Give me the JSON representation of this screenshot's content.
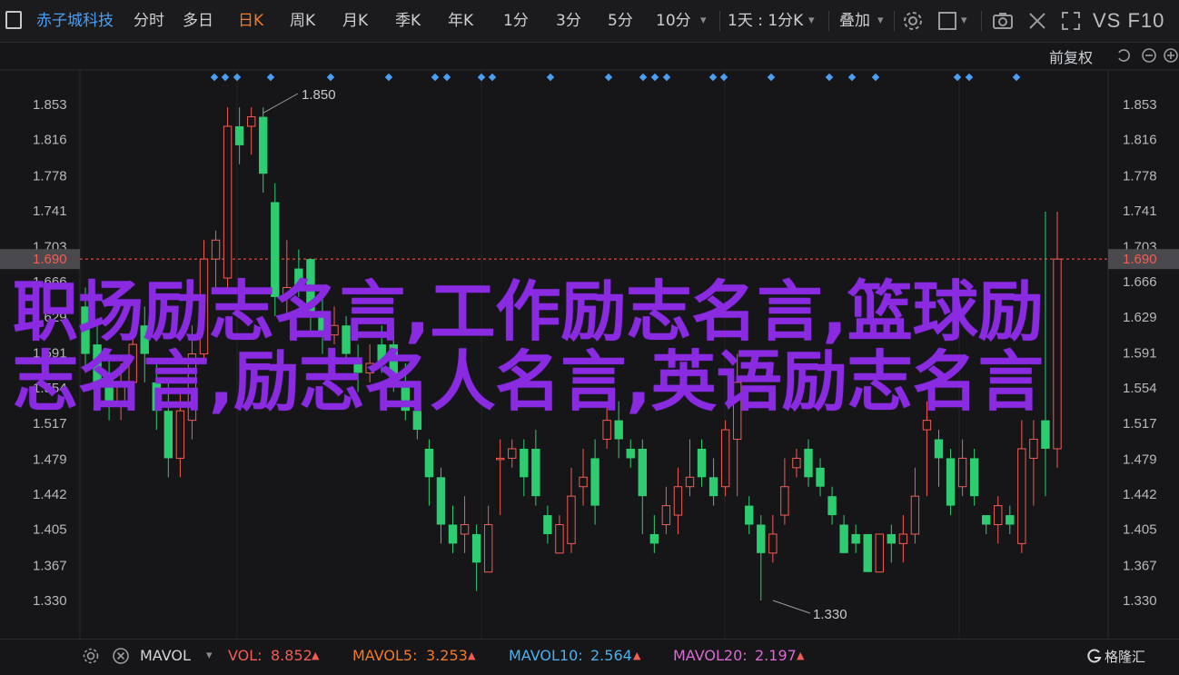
{
  "toolbar": {
    "stock_name": "赤子城科技",
    "periods": [
      "分时",
      "多日",
      "日K",
      "周K",
      "月K",
      "季K",
      "年K",
      "1分",
      "3分",
      "5分",
      "10分"
    ],
    "active_period": "日K",
    "dropdown_label": "1天 : 1分K",
    "indicator_label": "叠加",
    "brand": "VS F10"
  },
  "subbar": {
    "adjust_label": "前复权"
  },
  "chart": {
    "y_ticks": [
      "1.853",
      "1.816",
      "1.778",
      "1.741",
      "1.703",
      "1.666",
      "1.629",
      "1.591",
      "1.554",
      "1.517",
      "1.479",
      "1.442",
      "1.405",
      "1.367",
      "1.330"
    ],
    "y_tick_values": [
      1.853,
      1.816,
      1.778,
      1.741,
      1.703,
      1.666,
      1.629,
      1.591,
      1.554,
      1.517,
      1.479,
      1.442,
      1.405,
      1.367,
      1.33
    ],
    "current_price_label": "1.690",
    "current_price": 1.69,
    "high_label": "1.850",
    "low_label": "1.330",
    "colors": {
      "up": "#f25c54",
      "down": "#2ecc71",
      "marker": "#4a9ff5",
      "price_line": "#f25c54"
    }
  },
  "chart_data": {
    "type": "candlestick",
    "ylim": [
      1.318,
      1.868
    ],
    "candles": [
      {
        "o": 1.64,
        "c": 1.59,
        "h": 1.66,
        "l": 1.57
      },
      {
        "o": 1.6,
        "c": 1.56,
        "h": 1.62,
        "l": 1.54
      },
      {
        "o": 1.57,
        "c": 1.54,
        "h": 1.59,
        "l": 1.52
      },
      {
        "o": 1.54,
        "c": 1.56,
        "h": 1.58,
        "l": 1.52
      },
      {
        "o": 1.56,
        "c": 1.6,
        "h": 1.61,
        "l": 1.55
      },
      {
        "o": 1.62,
        "c": 1.59,
        "h": 1.64,
        "l": 1.56
      },
      {
        "o": 1.56,
        "c": 1.53,
        "h": 1.58,
        "l": 1.51
      },
      {
        "o": 1.53,
        "c": 1.48,
        "h": 1.56,
        "l": 1.46
      },
      {
        "o": 1.48,
        "c": 1.53,
        "h": 1.55,
        "l": 1.46
      },
      {
        "o": 1.52,
        "c": 1.59,
        "h": 1.62,
        "l": 1.5
      },
      {
        "o": 1.59,
        "c": 1.69,
        "h": 1.71,
        "l": 1.58
      },
      {
        "o": 1.69,
        "c": 1.71,
        "h": 1.72,
        "l": 1.66
      },
      {
        "o": 1.67,
        "c": 1.83,
        "h": 1.85,
        "l": 1.66
      },
      {
        "o": 1.83,
        "c": 1.81,
        "h": 1.85,
        "l": 1.79
      },
      {
        "o": 1.83,
        "c": 1.84,
        "h": 1.85,
        "l": 1.8
      },
      {
        "o": 1.84,
        "c": 1.78,
        "h": 1.85,
        "l": 1.76
      },
      {
        "o": 1.75,
        "c": 1.65,
        "h": 1.77,
        "l": 1.63
      },
      {
        "o": 1.65,
        "c": 1.66,
        "h": 1.71,
        "l": 1.63
      },
      {
        "o": 1.68,
        "c": 1.66,
        "h": 1.7,
        "l": 1.65
      },
      {
        "o": 1.69,
        "c": 1.63,
        "h": 1.69,
        "l": 1.61
      },
      {
        "o": 1.63,
        "c": 1.61,
        "h": 1.65,
        "l": 1.59
      },
      {
        "o": 1.61,
        "c": 1.62,
        "h": 1.64,
        "l": 1.6
      },
      {
        "o": 1.62,
        "c": 1.59,
        "h": 1.63,
        "l": 1.58
      },
      {
        "o": 1.58,
        "c": 1.57,
        "h": 1.6,
        "l": 1.55
      },
      {
        "o": 1.57,
        "c": 1.58,
        "h": 1.6,
        "l": 1.56
      },
      {
        "o": 1.6,
        "c": 1.58,
        "h": 1.62,
        "l": 1.57
      },
      {
        "o": 1.6,
        "c": 1.56,
        "h": 1.62,
        "l": 1.55
      },
      {
        "o": 1.56,
        "c": 1.53,
        "h": 1.58,
        "l": 1.52
      },
      {
        "o": 1.53,
        "c": 1.51,
        "h": 1.55,
        "l": 1.5
      },
      {
        "o": 1.49,
        "c": 1.46,
        "h": 1.5,
        "l": 1.43
      },
      {
        "o": 1.46,
        "c": 1.41,
        "h": 1.47,
        "l": 1.39
      },
      {
        "o": 1.41,
        "c": 1.39,
        "h": 1.43,
        "l": 1.38
      },
      {
        "o": 1.4,
        "c": 1.41,
        "h": 1.44,
        "l": 1.38
      },
      {
        "o": 1.4,
        "c": 1.37,
        "h": 1.41,
        "l": 1.34
      },
      {
        "o": 1.36,
        "c": 1.41,
        "h": 1.43,
        "l": 1.36
      },
      {
        "o": 1.48,
        "c": 1.48,
        "h": 1.5,
        "l": 1.42
      },
      {
        "o": 1.48,
        "c": 1.49,
        "h": 1.5,
        "l": 1.47
      },
      {
        "o": 1.49,
        "c": 1.46,
        "h": 1.5,
        "l": 1.44
      },
      {
        "o": 1.49,
        "c": 1.44,
        "h": 1.51,
        "l": 1.43
      },
      {
        "o": 1.42,
        "c": 1.4,
        "h": 1.43,
        "l": 1.39
      },
      {
        "o": 1.38,
        "c": 1.41,
        "h": 1.42,
        "l": 1.38
      },
      {
        "o": 1.39,
        "c": 1.44,
        "h": 1.47,
        "l": 1.38
      },
      {
        "o": 1.45,
        "c": 1.46,
        "h": 1.49,
        "l": 1.43
      },
      {
        "o": 1.48,
        "c": 1.43,
        "h": 1.5,
        "l": 1.41
      },
      {
        "o": 1.5,
        "c": 1.52,
        "h": 1.54,
        "l": 1.49
      },
      {
        "o": 1.52,
        "c": 1.5,
        "h": 1.54,
        "l": 1.48
      },
      {
        "o": 1.49,
        "c": 1.48,
        "h": 1.5,
        "l": 1.47
      },
      {
        "o": 1.49,
        "c": 1.44,
        "h": 1.5,
        "l": 1.4
      },
      {
        "o": 1.4,
        "c": 1.39,
        "h": 1.42,
        "l": 1.38
      },
      {
        "o": 1.41,
        "c": 1.43,
        "h": 1.45,
        "l": 1.4
      },
      {
        "o": 1.42,
        "c": 1.45,
        "h": 1.47,
        "l": 1.4
      },
      {
        "o": 1.45,
        "c": 1.46,
        "h": 1.5,
        "l": 1.44
      },
      {
        "o": 1.49,
        "c": 1.46,
        "h": 1.5,
        "l": 1.45
      },
      {
        "o": 1.46,
        "c": 1.44,
        "h": 1.48,
        "l": 1.43
      },
      {
        "o": 1.45,
        "c": 1.51,
        "h": 1.52,
        "l": 1.44
      },
      {
        "o": 1.5,
        "c": 1.56,
        "h": 1.59,
        "l": 1.44
      },
      {
        "o": 1.43,
        "c": 1.41,
        "h": 1.44,
        "l": 1.4
      },
      {
        "o": 1.41,
        "c": 1.38,
        "h": 1.42,
        "l": 1.33
      },
      {
        "o": 1.38,
        "c": 1.4,
        "h": 1.42,
        "l": 1.37
      },
      {
        "o": 1.42,
        "c": 1.45,
        "h": 1.48,
        "l": 1.41
      },
      {
        "o": 1.47,
        "c": 1.48,
        "h": 1.49,
        "l": 1.46
      },
      {
        "o": 1.49,
        "c": 1.46,
        "h": 1.5,
        "l": 1.45
      },
      {
        "o": 1.47,
        "c": 1.45,
        "h": 1.48,
        "l": 1.44
      },
      {
        "o": 1.44,
        "c": 1.42,
        "h": 1.45,
        "l": 1.41
      },
      {
        "o": 1.41,
        "c": 1.38,
        "h": 1.42,
        "l": 1.38
      },
      {
        "o": 1.4,
        "c": 1.39,
        "h": 1.41,
        "l": 1.38
      },
      {
        "o": 1.4,
        "c": 1.36,
        "h": 1.4,
        "l": 1.36
      },
      {
        "o": 1.36,
        "c": 1.4,
        "h": 1.4,
        "l": 1.36
      },
      {
        "o": 1.4,
        "c": 1.39,
        "h": 1.41,
        "l": 1.37
      },
      {
        "o": 1.39,
        "c": 1.4,
        "h": 1.42,
        "l": 1.37
      },
      {
        "o": 1.4,
        "c": 1.44,
        "h": 1.47,
        "l": 1.39
      },
      {
        "o": 1.51,
        "c": 1.52,
        "h": 1.54,
        "l": 1.44
      },
      {
        "o": 1.5,
        "c": 1.48,
        "h": 1.51,
        "l": 1.45
      },
      {
        "o": 1.48,
        "c": 1.43,
        "h": 1.49,
        "l": 1.42
      },
      {
        "o": 1.45,
        "c": 1.48,
        "h": 1.5,
        "l": 1.44
      },
      {
        "o": 1.48,
        "c": 1.44,
        "h": 1.49,
        "l": 1.43
      },
      {
        "o": 1.42,
        "c": 1.41,
        "h": 1.42,
        "l": 1.4
      },
      {
        "o": 1.41,
        "c": 1.43,
        "h": 1.44,
        "l": 1.39
      },
      {
        "o": 1.42,
        "c": 1.41,
        "h": 1.43,
        "l": 1.4
      },
      {
        "o": 1.39,
        "c": 1.49,
        "h": 1.52,
        "l": 1.38
      },
      {
        "o": 1.48,
        "c": 1.5,
        "h": 1.52,
        "l": 1.43
      },
      {
        "o": 1.52,
        "c": 1.49,
        "h": 1.74,
        "l": 1.44
      },
      {
        "o": 1.49,
        "c": 1.69,
        "h": 1.74,
        "l": 1.47
      }
    ],
    "markers_count": 24
  },
  "bottom": {
    "indicator": "MAVOL",
    "items": [
      {
        "label": "VOL:",
        "value": "8.852",
        "color": "#f25c54"
      },
      {
        "label": "MAVOL5:",
        "value": "3.253",
        "color": "#f07a28"
      },
      {
        "label": "MAVOL10:",
        "value": "2.564",
        "color": "#4ab0ef"
      },
      {
        "label": "MAVOL20:",
        "value": "2.197",
        "color": "#d86ad2"
      }
    ],
    "watermark": "格隆汇"
  },
  "overlay": {
    "line1": "职场励志名言,工作励志名言,篮球励",
    "line2": "志名言,励志名人名言,英语励志名言"
  }
}
